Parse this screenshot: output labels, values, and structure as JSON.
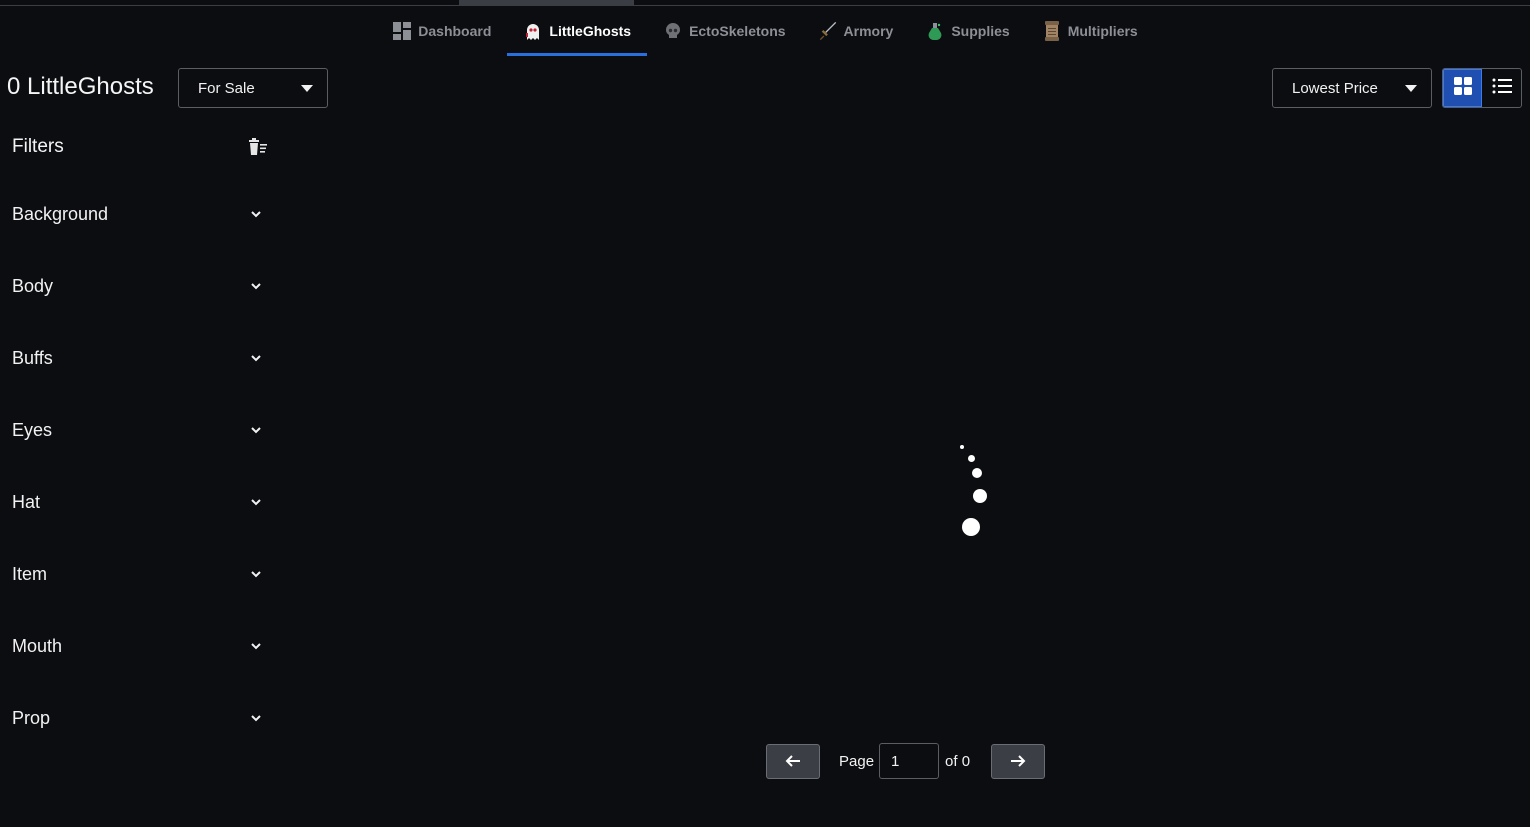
{
  "nav": {
    "tabs": [
      {
        "label": "Dashboard",
        "icon": "dashboard-icon",
        "active": false
      },
      {
        "label": "LittleGhosts",
        "icon": "ghost-icon",
        "active": true
      },
      {
        "label": "EctoSkeletons",
        "icon": "skull-icon",
        "active": false
      },
      {
        "label": "Armory",
        "icon": "sword-icon",
        "active": false
      },
      {
        "label": "Supplies",
        "icon": "potion-icon",
        "active": false
      },
      {
        "label": "Multipliers",
        "icon": "scroll-icon",
        "active": false
      }
    ]
  },
  "header": {
    "count_title": "0 LittleGhosts",
    "status_filter": "For Sale",
    "sort": "Lowest Price",
    "view_mode": "grid"
  },
  "filters": {
    "title": "Filters",
    "categories": [
      "Background",
      "Body",
      "Buffs",
      "Eyes",
      "Hat",
      "Item",
      "Mouth",
      "Prop"
    ]
  },
  "pagination": {
    "page_label": "Page",
    "current_page": "1",
    "of_label": "of 0"
  },
  "colors": {
    "background": "#0c0d11",
    "accent": "#2a6fe0",
    "inactive_tab": "#8c8f96"
  }
}
